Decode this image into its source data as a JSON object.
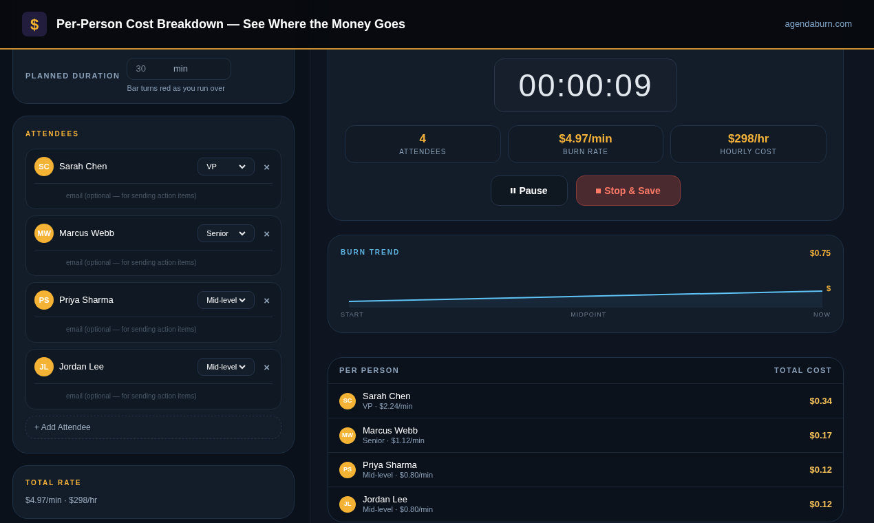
{
  "header": {
    "logo_glyph": "$",
    "title": "Per-Person Cost Breakdown — See Where the Money Goes",
    "site": "agendaburn.com"
  },
  "duration": {
    "label": "PLANNED DURATION",
    "value": "30",
    "unit": "min",
    "hint": "Bar turns red as you run over"
  },
  "attendees": {
    "title": "ATTENDEES",
    "add_button": "+ Add Attendee",
    "items": [
      {
        "initials": "SC",
        "name": "Sarah Chen",
        "role": "VP",
        "remove_glyph": "×",
        "email_placeholder": "email (optional — for sending action items)"
      },
      {
        "initials": "MW",
        "name": "Marcus Webb",
        "role": "Senior",
        "remove_glyph": "×",
        "email_placeholder": "email (optional — for sending action items)"
      },
      {
        "initials": "PS",
        "name": "Priya Sharma",
        "role": "Mid-level",
        "remove_glyph": "×",
        "email_placeholder": "email (optional — for sending action items)"
      },
      {
        "initials": "JL",
        "name": "Jordan Lee",
        "role": "Mid-level",
        "remove_glyph": "×",
        "email_placeholder": "email (optional — for sending action items)"
      }
    ]
  },
  "total_rate": {
    "title": "TOTAL RATE",
    "value": "$4.97/min · $298/hr"
  },
  "timer": {
    "time": "00:00:09",
    "stats": [
      {
        "value": "4",
        "label": "ATTENDEES"
      },
      {
        "value": "$4.97/min",
        "label": "BURN RATE"
      },
      {
        "value": "$298/hr",
        "label": "HOURLY COST"
      }
    ],
    "buttons": [
      {
        "kind": "pause",
        "label": "Pause"
      },
      {
        "kind": "stop",
        "label": "Stop & Save"
      }
    ]
  },
  "burn_trend": {
    "title": "BURN TREND",
    "value": "$0.75",
    "marker": "$",
    "axis_labels": [
      "START",
      "MIDPOINT",
      "NOW"
    ]
  },
  "per_person": {
    "columns": [
      "PER PERSON",
      "TOTAL COST"
    ],
    "rows": [
      {
        "initials": "SC",
        "name": "Sarah Chen",
        "detail": "VP · $2.24/min",
        "cost": "$0.34"
      },
      {
        "initials": "MW",
        "name": "Marcus Webb",
        "detail": "Senior · $1.12/min",
        "cost": "$0.17"
      },
      {
        "initials": "PS",
        "name": "Priya Sharma",
        "detail": "Mid-level · $0.80/min",
        "cost": "$0.12"
      },
      {
        "initials": "JL",
        "name": "Jordan Lee",
        "detail": "Mid-level · $0.80/min",
        "cost": "$0.12"
      }
    ]
  }
}
